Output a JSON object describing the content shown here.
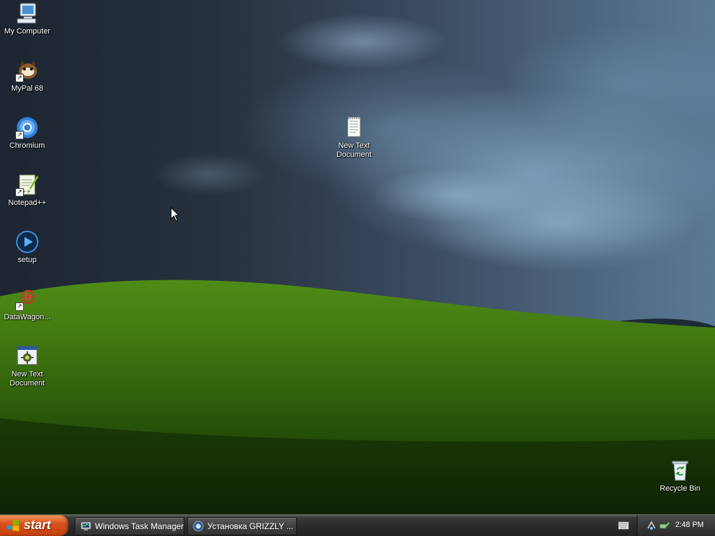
{
  "desktop": {
    "icons": [
      {
        "label": "My Computer",
        "icon": "my-computer-icon"
      },
      {
        "label": "MyPal 68",
        "icon": "mypal-browser-icon",
        "shortcut": true
      },
      {
        "label": "Chromium",
        "icon": "chromium-icon",
        "shortcut": true
      },
      {
        "label": "Notepad++",
        "icon": "notepad-plus-plus-icon",
        "shortcut": true
      },
      {
        "label": "setup",
        "icon": "setup-play-icon"
      },
      {
        "label": "DataWagon...",
        "icon": "datawagon-icon",
        "shortcut": true
      },
      {
        "label": "New Text Document",
        "icon": "text-document-exe-icon"
      },
      {
        "label": "New Text Document",
        "icon": "text-document-icon"
      },
      {
        "label": "Recycle Bin",
        "icon": "recycle-bin-icon"
      }
    ]
  },
  "taskbar": {
    "start_label": "start",
    "tasks": [
      {
        "label": "Windows Task Manager",
        "icon": "task-manager-icon"
      },
      {
        "label": "Установка GRIZZLY ...",
        "icon": "installer-icon"
      }
    ],
    "tray": {
      "clock": "2:48 PM",
      "icons": [
        "keyboard-icon",
        "network-icon",
        "safely-remove-icon"
      ]
    }
  },
  "colors": {
    "start_button": "#d9531e",
    "taskbar": "#2b2b2b",
    "hill_green": "#3f7a10",
    "sky_dark": "#1d2531"
  }
}
